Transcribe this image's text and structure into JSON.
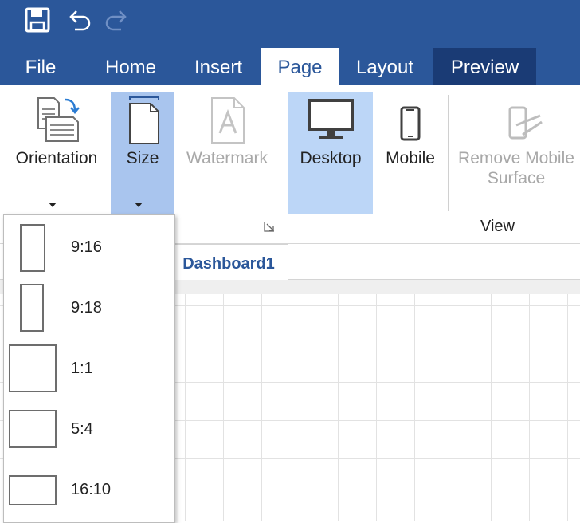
{
  "quick_access": {
    "icons": [
      "save-icon",
      "undo-icon",
      "redo-icon"
    ]
  },
  "tabs": [
    {
      "label": "File"
    },
    {
      "label": "Home"
    },
    {
      "label": "Insert"
    },
    {
      "label": "Page",
      "active": true
    },
    {
      "label": "Layout"
    },
    {
      "label": "Preview"
    }
  ],
  "ribbon": {
    "orientation": {
      "label": "Orientation"
    },
    "size": {
      "label": "Size"
    },
    "watermark": {
      "label": "Watermark"
    },
    "desktop": {
      "label": "Desktop"
    },
    "mobile": {
      "label": "Mobile"
    },
    "remove_mobile_surface": {
      "label_line1": "Remove Mobile",
      "label_line2": "Surface"
    },
    "view_group_label": "View"
  },
  "document": {
    "tab_label": "Dashboard1"
  },
  "size_menu": {
    "items": [
      {
        "label": "9:16"
      },
      {
        "label": "9:18"
      },
      {
        "label": "1:1"
      },
      {
        "label": "5:4"
      },
      {
        "label": "16:10"
      }
    ]
  },
  "colors": {
    "accent": "#2b579a",
    "preview_tab": "#1a3b75",
    "selected_button": "#a9c5ee",
    "selected_view": "#bcd6f7",
    "disabled_text": "#a8a8a8"
  }
}
